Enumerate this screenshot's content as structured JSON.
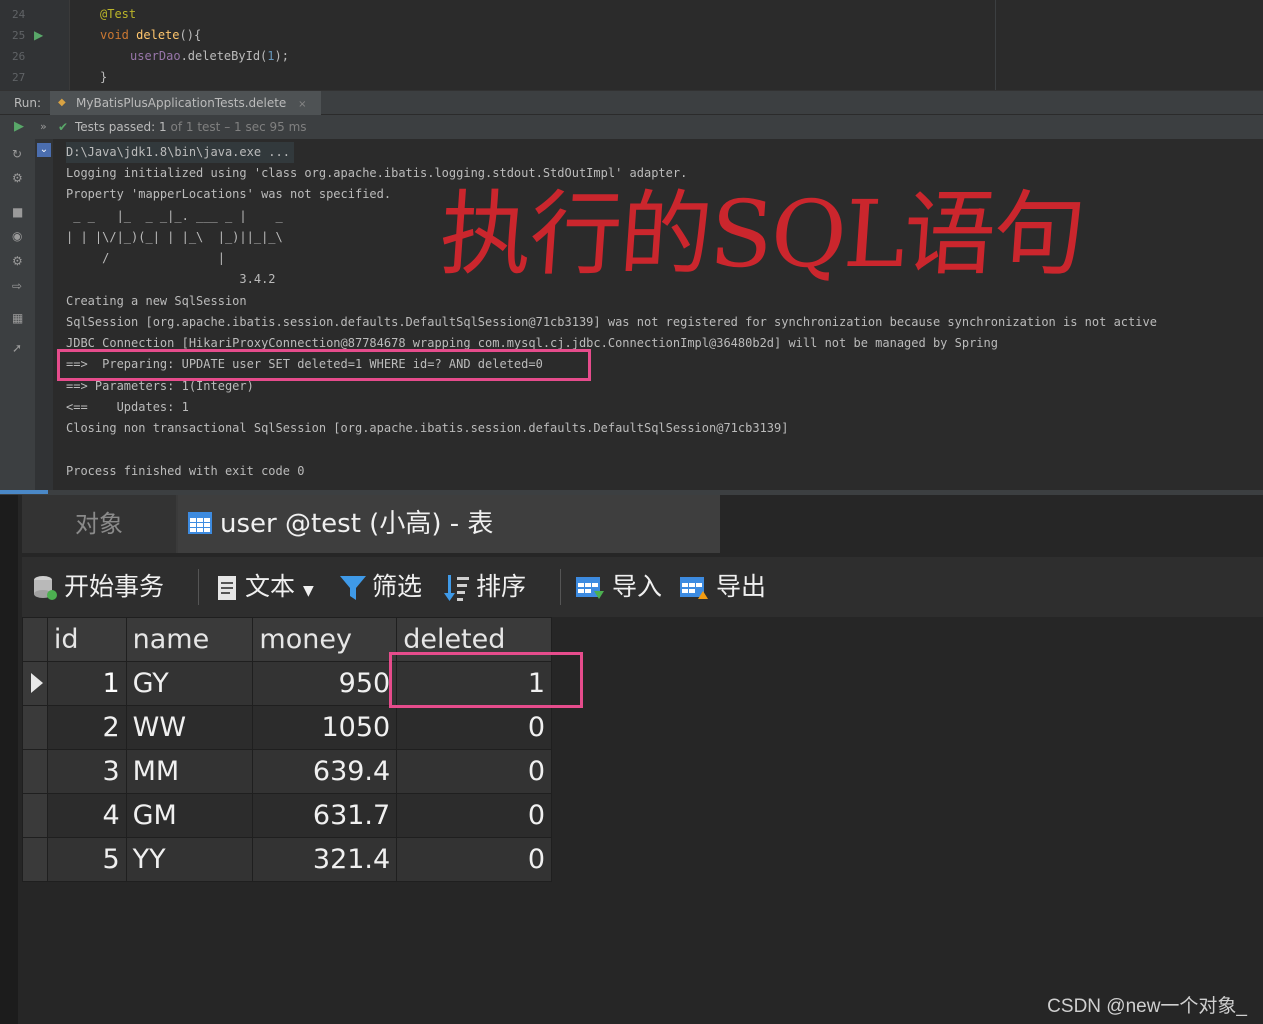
{
  "editor": {
    "lines": [
      {
        "num": "24",
        "annotation": "@Test"
      },
      {
        "num": "25",
        "kw": "void",
        "fn": "delete",
        "rest": "(){"
      },
      {
        "num": "26",
        "field": "userDao",
        "call": ".deleteById(",
        "arg": "1",
        "end": ");"
      },
      {
        "num": "27",
        "brace": "}"
      }
    ]
  },
  "run": {
    "label": "Run:",
    "tab": "MyBatisPlusApplicationTests.delete",
    "close": "×"
  },
  "status": {
    "passed_label": "Tests passed:",
    "passed_count": "1",
    "passed_rest": "of 1 test – 1 sec 95 ms"
  },
  "console": {
    "lines": [
      "D:\\Java\\jdk1.8\\bin\\java.exe ...",
      "Logging initialized using 'class org.apache.ibatis.logging.stdout.StdOutImpl' adapter.",
      "Property 'mapperLocations' was not specified.",
      " _ _   |_  _ _|_. ___ _ |    _",
      "| | |\\/|_)(_| | |_\\  |_)||_|_\\",
      "     /               |",
      "                        3.4.2",
      "Creating a new SqlSession",
      "SqlSession [org.apache.ibatis.session.defaults.DefaultSqlSession@71cb3139] was not registered for synchronization because synchronization is not active",
      "JDBC Connection [HikariProxyConnection@87784678 wrapping com.mysql.cj.jdbc.ConnectionImpl@36480b2d] will not be managed by Spring",
      "==>  Preparing: UPDATE user SET deleted=1 WHERE id=? AND deleted=0",
      "==> Parameters: 1(Integer)",
      "<==    Updates: 1",
      "Closing non transactional SqlSession [org.apache.ibatis.session.defaults.DefaultSqlSession@71cb3139]",
      "",
      "Process finished with exit code 0"
    ],
    "annotation": "执行的SQL语句"
  },
  "navicat": {
    "tab_objects": "对象",
    "tab_table": "user @test (小高) - 表",
    "toolbar": {
      "begin_tx": "开始事务",
      "text": "文本",
      "filter": "筛选",
      "sort": "排序",
      "import": "导入",
      "export": "导出"
    },
    "columns": [
      "id",
      "name",
      "money",
      "deleted"
    ],
    "rows": [
      {
        "id": "1",
        "name": "GY",
        "money": "950",
        "deleted": "1"
      },
      {
        "id": "2",
        "name": "WW",
        "money": "1050",
        "deleted": "0"
      },
      {
        "id": "3",
        "name": "MM",
        "money": "639.4",
        "deleted": "0"
      },
      {
        "id": "4",
        "name": "GM",
        "money": "631.7",
        "deleted": "0"
      },
      {
        "id": "5",
        "name": "YY",
        "money": "321.4",
        "deleted": "0"
      }
    ]
  },
  "watermark": "CSDN @new一个对象_",
  "colors": {
    "highlight": "#e64c8c",
    "annotation_red": "#d9262e",
    "selection_blue": "#1e88e5"
  }
}
